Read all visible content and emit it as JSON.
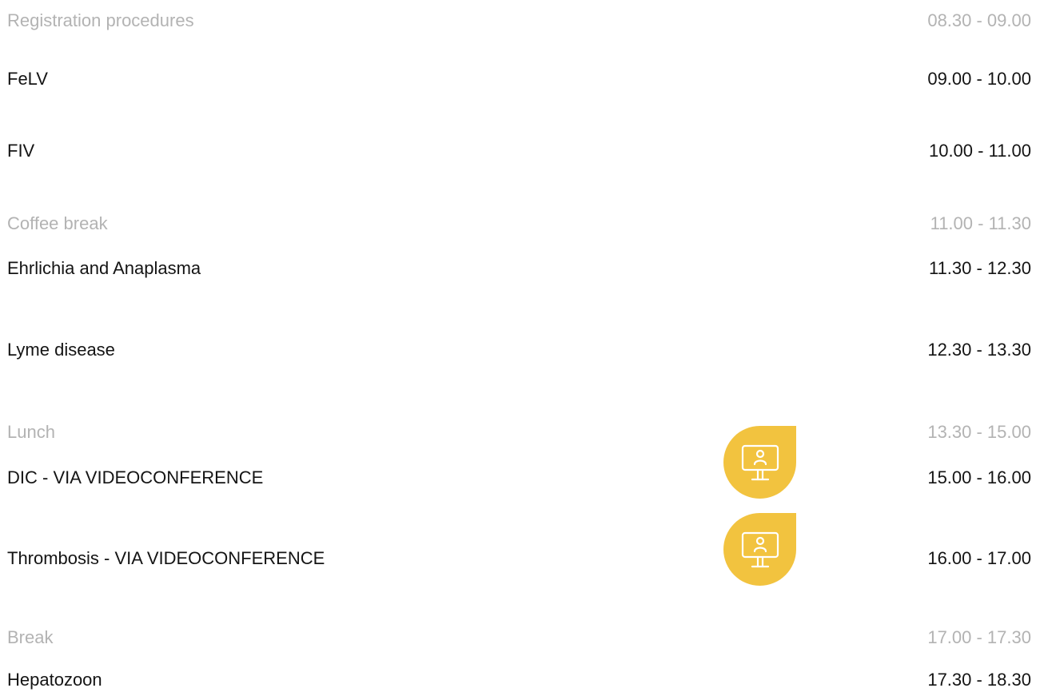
{
  "accent_color": "#f2c33f",
  "icon_color": "#ffffff",
  "break_text_color": "#b3b3b3",
  "session_text_color": "#141414",
  "schedule": [
    {
      "type": "break",
      "title": "Registration procedures",
      "time": "08.30 - 09.00"
    },
    {
      "type": "session",
      "title": "FeLV",
      "time": "09.00 - 10.00"
    },
    {
      "type": "session",
      "title": "FIV",
      "time": "10.00 - 11.00"
    },
    {
      "type": "break",
      "title": "Coffee break",
      "time": "11.00 - 11.30"
    },
    {
      "type": "session",
      "title": "Ehrlichia and Anaplasma",
      "time": "11.30 - 12.30"
    },
    {
      "type": "session",
      "title": "Lyme disease",
      "time": "12.30 - 13.30"
    },
    {
      "type": "break",
      "title": "Lunch",
      "time": "13.30 - 15.00"
    },
    {
      "type": "session",
      "title": "DIC - VIA VIDEOCONFERENCE",
      "time": "15.00 - 16.00",
      "icon": "videoconference-icon"
    },
    {
      "type": "session",
      "title": "Thrombosis - VIA VIDEOCONFERENCE",
      "time": "16.00 - 17.00",
      "icon": "videoconference-icon"
    },
    {
      "type": "break",
      "title": "Break",
      "time": "17.00 - 17.30"
    },
    {
      "type": "session",
      "title": "Hepatozoon",
      "time": "17.30 - 18.30"
    }
  ]
}
